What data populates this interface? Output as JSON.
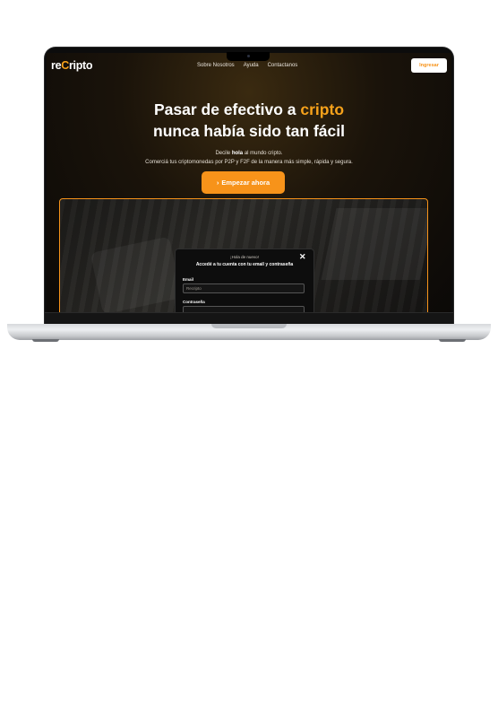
{
  "brand": {
    "logo_prefix": "re",
    "logo_accent": "C",
    "logo_suffix": "ripto"
  },
  "nav": {
    "items": [
      "Sobre Nosotros",
      "Ayuda",
      "Contactanos"
    ],
    "login_label": "Ingresar"
  },
  "hero": {
    "title_part1": "Pasar de efectivo a ",
    "title_accent": "cripto",
    "title_line2": "nunca había sido tan fácil",
    "sub_line1_pre": "Decile ",
    "sub_line1_bold": "hola",
    "sub_line1_post": " al mundo cripto.",
    "sub_line2": "Comerciá tus criptomonedas por P2P y F2F de la manera más simple, rápida y segura.",
    "cta_label": "Empezar ahora",
    "cta_icon": "arrow-icon"
  },
  "login_modal": {
    "greeting": "¡Hola de nuevo!",
    "title": "Accedé a tu cuenta con tu email y contraseña",
    "email_label": "Email",
    "email_placeholder": "Recripto",
    "password_label": "Contraseña"
  },
  "colors": {
    "accent": "#f7931a",
    "accent_text": "#f7a21b",
    "background_dark": "#0b0907"
  }
}
